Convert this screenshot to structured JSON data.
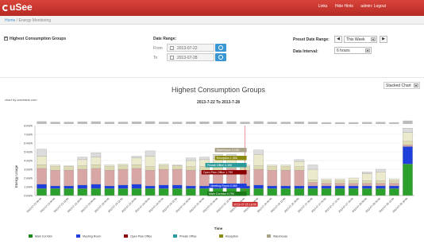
{
  "app": {
    "logo": "uSee"
  },
  "topnav": {
    "links": "Links",
    "hide_hints": "Hide Hints",
    "admin": "admin: Logout"
  },
  "breadcrumb": {
    "home": "Home",
    "sep": "/",
    "current": "Energy Monitoring"
  },
  "filters": {
    "group_label": "Highest Consumption Groups",
    "date_range_label": "Date Range:",
    "from_label": "From",
    "from_value": "2013-07-22",
    "to_label": "To",
    "to_value": "2013-07-28",
    "preset_label": "Preset Date Range:",
    "preset_value": "This Week",
    "prev_btn": "◀",
    "next_btn": "▶",
    "interval_label": "Data Interval:",
    "interval_value": "6 hours"
  },
  "chart_controls": {
    "chart_type": "Stacked Chart",
    "credit": "chart by amcharts.com"
  },
  "chart_data": {
    "type": "bar",
    "title": "Highest Consumption Groups",
    "subtitle": "2013-7-22 To 2013-7-28",
    "xlabel": "Time",
    "ylabel": "Energy Usage",
    "ylim": [
      0,
      8
    ],
    "yticks": [
      "0 kWh",
      "1 kWh",
      "2 kWh",
      "3 kWh",
      "4 kWh",
      "5 kWh",
      "6 kWh",
      "7 kWh",
      "8 kWh"
    ],
    "categories": [
      "2013-07-22 00:00",
      "2013-07-22 06:00",
      "2013-07-22 12:00",
      "2013-07-22 18:00",
      "2013-07-23 00:00",
      "2013-07-23 06:00",
      "2013-07-23 12:00",
      "2013-07-23 18:00",
      "2013-07-24 00:00",
      "2013-07-24 06:00",
      "2013-07-24 12:00",
      "2013-07-24 18:00",
      "2013-07-25 00:00",
      "2013-07-25 06:00",
      "2013-07-25 12:00",
      "2013-07-25 18:00",
      "2013-07-26 00:00",
      "2013-07-26 06:00",
      "2013-07-26 12:00",
      "2013-07-26 18:00",
      "2013-07-27 00:00",
      "2013-07-27 06:00",
      "2013-07-27 12:00",
      "2013-07-27 18:00",
      "2013-07-28 00:00",
      "2013-07-28 06:00",
      "2013-07-28 12:00",
      "2013-07-28 18:00"
    ],
    "series": [
      {
        "name": "Main Corridor",
        "color": "#2ca02c",
        "values": [
          0.8,
          0.8,
          0.8,
          0.8,
          0.8,
          0.8,
          0.8,
          0.8,
          0.8,
          0.8,
          0.8,
          0.8,
          0.8,
          0.8,
          0.8,
          0.8,
          0.8,
          0.8,
          0.8,
          0.8,
          0.8,
          0.8,
          0.8,
          0.8,
          0.8,
          0.8,
          0.8,
          3.6
        ]
      },
      {
        "name": "Meeting Room",
        "color": "#1f3fdc",
        "values": [
          0.5,
          0.3,
          0.3,
          0.4,
          0.5,
          0.3,
          0.4,
          0.5,
          0.3,
          0.4,
          0.4,
          0.3,
          0.3,
          0.3,
          0.5,
          0.3,
          0.4,
          0.3,
          0.3,
          0.3,
          0.3,
          0.3,
          0.3,
          0.3,
          0.3,
          0.3,
          0.3,
          2.0
        ]
      },
      {
        "name": "Open Plan Office",
        "color": "#d9a6a6",
        "values": [
          1.8,
          1.8,
          1.8,
          1.8,
          1.8,
          1.8,
          1.8,
          1.8,
          1.8,
          1.8,
          1.8,
          1.8,
          1.8,
          1.8,
          1.8,
          1.8,
          1.8,
          1.8,
          1.8,
          1.8,
          0.4,
          0.3,
          0.3,
          0.3,
          0.3,
          0.3,
          0.3,
          0.2
        ]
      },
      {
        "name": "Private Office",
        "color": "#ddd9b0",
        "values": [
          0.4,
          0.4,
          0.4,
          0.4,
          0.4,
          0.4,
          0.4,
          0.4,
          0.4,
          0.4,
          0.4,
          0.4,
          0.4,
          0.4,
          0.4,
          0.4,
          0.4,
          0.4,
          0.4,
          0.4,
          0.3,
          0.3,
          0.3,
          0.3,
          0.3,
          0.3,
          0.3,
          0.4
        ]
      },
      {
        "name": "Reception",
        "color": "#eceacc",
        "values": [
          1.0,
          0.2,
          0.1,
          0.7,
          0.9,
          0.2,
          0.2,
          0.8,
          1.2,
          0.2,
          0.1,
          0.7,
          0.8,
          0.9,
          0.7,
          0.2,
          1.3,
          0.2,
          0.2,
          0.6,
          1.2,
          0.2,
          0.2,
          0.3,
          0.8,
          1.0,
          0.2,
          1.0
        ]
      },
      {
        "name": "Warehouse",
        "color": "#dcdcdc",
        "values": [
          0.8,
          0.0,
          0.0,
          0.3,
          0.5,
          0.0,
          0.0,
          0.2,
          0.6,
          0.0,
          0.0,
          0.3,
          0.3,
          0.5,
          0.5,
          0.0,
          0.5,
          0.0,
          0.0,
          0.2,
          0.5,
          0.0,
          0.0,
          0.0,
          0.2,
          0.3,
          0.0,
          0.5
        ]
      }
    ],
    "tooltip": {
      "items": [
        {
          "text": "Warehouse 0.155",
          "color": "#aaa38a"
        },
        {
          "text": "Reception 1.355",
          "color": "#8a8a10"
        },
        {
          "text": "Private Office 0.498",
          "color": "#2a9a9a"
        },
        {
          "text": "Open Plan Office 1.799",
          "color": "#8b0000"
        },
        {
          "text": "Meeting Room 0.360",
          "color": "#1f3fdc"
        },
        {
          "text": "Main Corridor 0.790",
          "color": "#1a7a1a"
        }
      ],
      "cursor_label": "2013-07-25 18:00"
    },
    "legend": [
      "Main Corridor",
      "Meeting Room",
      "Open Plan Office",
      "Private Office",
      "Reception",
      "Warehouse"
    ],
    "legend_colors": [
      "#1a8a1a",
      "#1f3fdc",
      "#8b0000",
      "#2a9a9a",
      "#8a8a10",
      "#aaa38a"
    ]
  }
}
